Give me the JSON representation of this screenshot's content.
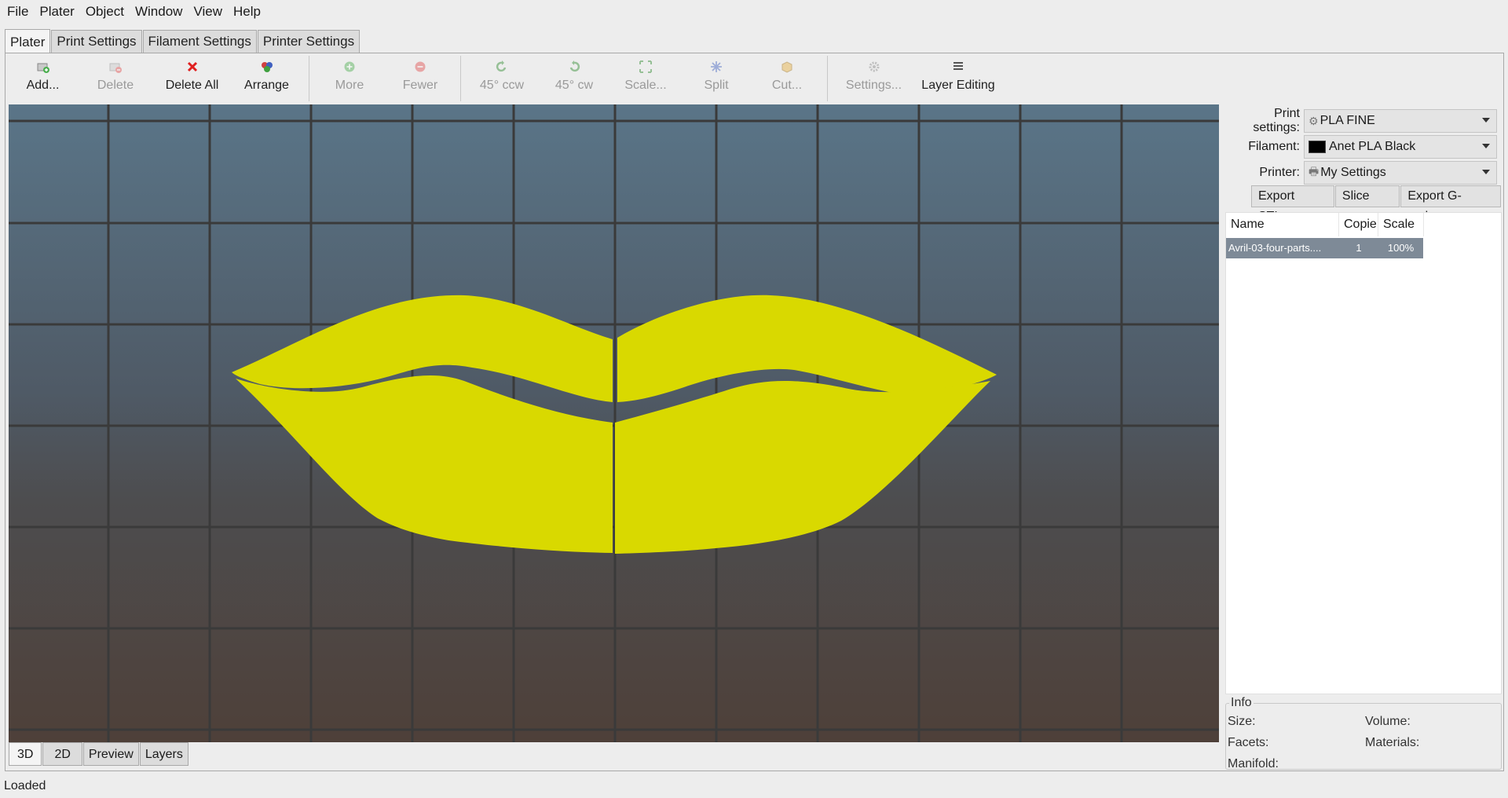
{
  "menu": [
    "File",
    "Plater",
    "Object",
    "Window",
    "View",
    "Help"
  ],
  "tabs": [
    "Plater",
    "Print Settings",
    "Filament Settings",
    "Printer Settings"
  ],
  "toolbar": [
    {
      "label": "Add...",
      "icon": "add-brick-icon",
      "enabled": true
    },
    {
      "label": "Delete",
      "icon": "delete-brick-icon",
      "enabled": false
    },
    {
      "label": "Delete All",
      "icon": "cross-icon",
      "enabled": true
    },
    {
      "label": "Arrange",
      "icon": "bricks-icon",
      "enabled": true
    },
    {
      "label": "More",
      "icon": "plus-circle-icon",
      "enabled": false
    },
    {
      "label": "Fewer",
      "icon": "minus-circle-icon",
      "enabled": false
    },
    {
      "label": "45° ccw",
      "icon": "rotate-ccw-icon",
      "enabled": false
    },
    {
      "label": "45° cw",
      "icon": "rotate-cw-icon",
      "enabled": false
    },
    {
      "label": "Scale...",
      "icon": "arrows-expand-icon",
      "enabled": false
    },
    {
      "label": "Split",
      "icon": "split-icon",
      "enabled": false
    },
    {
      "label": "Cut...",
      "icon": "package-icon",
      "enabled": false
    },
    {
      "label": "Settings...",
      "icon": "gear-icon",
      "enabled": false
    },
    {
      "label": "Layer Editing",
      "icon": "layers-icon",
      "enabled": true
    }
  ],
  "view_tabs": [
    "3D",
    "2D",
    "Preview",
    "Layers"
  ],
  "presets": {
    "print_label": "Print settings:",
    "print_value": "PLA FINE",
    "filament_label": "Filament:",
    "filament_value": "Anet PLA Black",
    "filament_color": "#000000",
    "printer_label": "Printer:",
    "printer_value": "My Settings"
  },
  "actions": {
    "export_stl": "Export STL...",
    "slice_now": "Slice now",
    "export_gcode": "Export G-code..."
  },
  "object_list": {
    "columns": [
      "Name",
      "Copie",
      "Scale"
    ],
    "rows": [
      {
        "name": "Avril-03-four-parts....",
        "copies": "1",
        "scale": "100%"
      }
    ]
  },
  "info": {
    "legend": "Info",
    "size_label": "Size:",
    "volume_label": "Volume:",
    "facets_label": "Facets:",
    "materials_label": "Materials:",
    "manifold_label": "Manifold:"
  },
  "status": "Loaded",
  "colors": {
    "model": "#d9d900",
    "grid": "#3a3a3a",
    "selection": "#7e8a97"
  }
}
